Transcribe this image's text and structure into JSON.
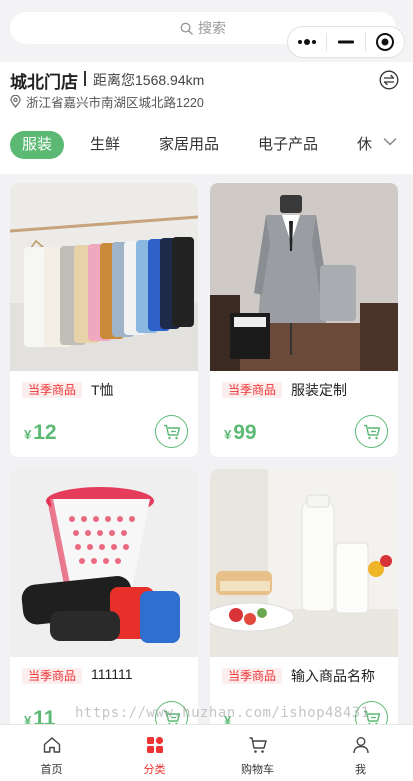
{
  "search": {
    "placeholder": "搜索"
  },
  "store": {
    "name": "城北门店",
    "distance": "距离您1568.94km",
    "address": "浙江省嘉兴市南湖区城北路1220"
  },
  "categories": [
    {
      "label": "服装",
      "active": true
    },
    {
      "label": "生鲜"
    },
    {
      "label": "家居用品"
    },
    {
      "label": "电子产品"
    },
    {
      "label": "休"
    }
  ],
  "products": [
    {
      "tag": "当季商品",
      "name": "T恤",
      "currency": "¥",
      "price": "12"
    },
    {
      "tag": "当季商品",
      "name": "服装定制",
      "currency": "¥",
      "price": "99"
    },
    {
      "tag": "当季商品",
      "name": "111111",
      "currency": "¥",
      "price": "11"
    },
    {
      "tag": "当季商品",
      "name": "输入商品名称",
      "currency": "¥",
      "price": ""
    }
  ],
  "watermark": "https://www.huzhan.com/ishop48431",
  "tabbar": [
    {
      "label": "首页",
      "icon": "home-icon"
    },
    {
      "label": "分类",
      "icon": "category-icon",
      "active": true
    },
    {
      "label": "购物车",
      "icon": "cart-icon"
    },
    {
      "label": "我",
      "icon": "user-icon"
    }
  ],
  "colors": {
    "accent": "#5cb974",
    "tag_red": "#e33333",
    "active_tab_red": "#e33333"
  }
}
